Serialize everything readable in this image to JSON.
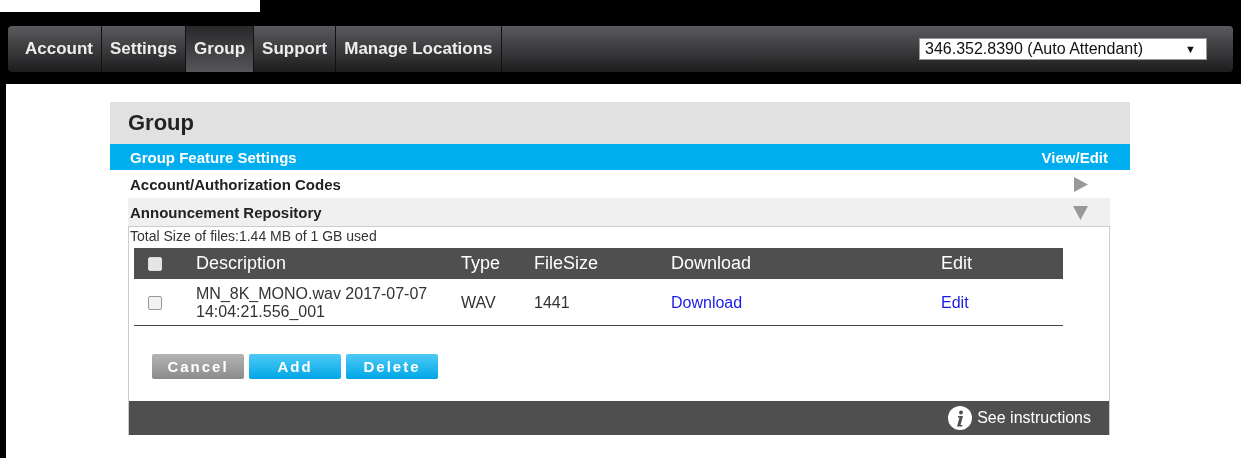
{
  "nav": {
    "tabs": [
      {
        "label": "Account",
        "selected": false
      },
      {
        "label": "Settings",
        "selected": false
      },
      {
        "label": "Group",
        "selected": true
      },
      {
        "label": "Support",
        "selected": false
      },
      {
        "label": "Manage Locations",
        "selected": false
      }
    ],
    "account_select": {
      "value": "346.352.8390 (Auto Attendant)",
      "arrow": "▼"
    }
  },
  "panel": {
    "title": "Group",
    "section": {
      "title": "Group Feature Settings",
      "link": "View/Edit"
    },
    "items": [
      {
        "title": "Account/Authorization Codes",
        "expanded": false
      },
      {
        "title": "Announcement Repository",
        "expanded": true,
        "usage": "Total Size of files:1.44 MB of 1 GB used",
        "table": {
          "select_all": false,
          "columns": [
            "Description",
            "Type",
            "FileSize",
            "Download",
            "Edit"
          ],
          "rows": [
            {
              "checked": false,
              "description": "MN_8K_MONO.wav 2017-07-07 14:04:21.556_001",
              "type": "WAV",
              "filesize": "1441",
              "download": "Download",
              "edit": "Edit"
            }
          ]
        },
        "buttons": [
          {
            "label": "Cancel",
            "kind": "secondary"
          },
          {
            "label": "Add",
            "kind": "primary"
          },
          {
            "label": "Delete",
            "kind": "primary"
          }
        ],
        "footer_link": "See instructions"
      }
    ]
  }
}
